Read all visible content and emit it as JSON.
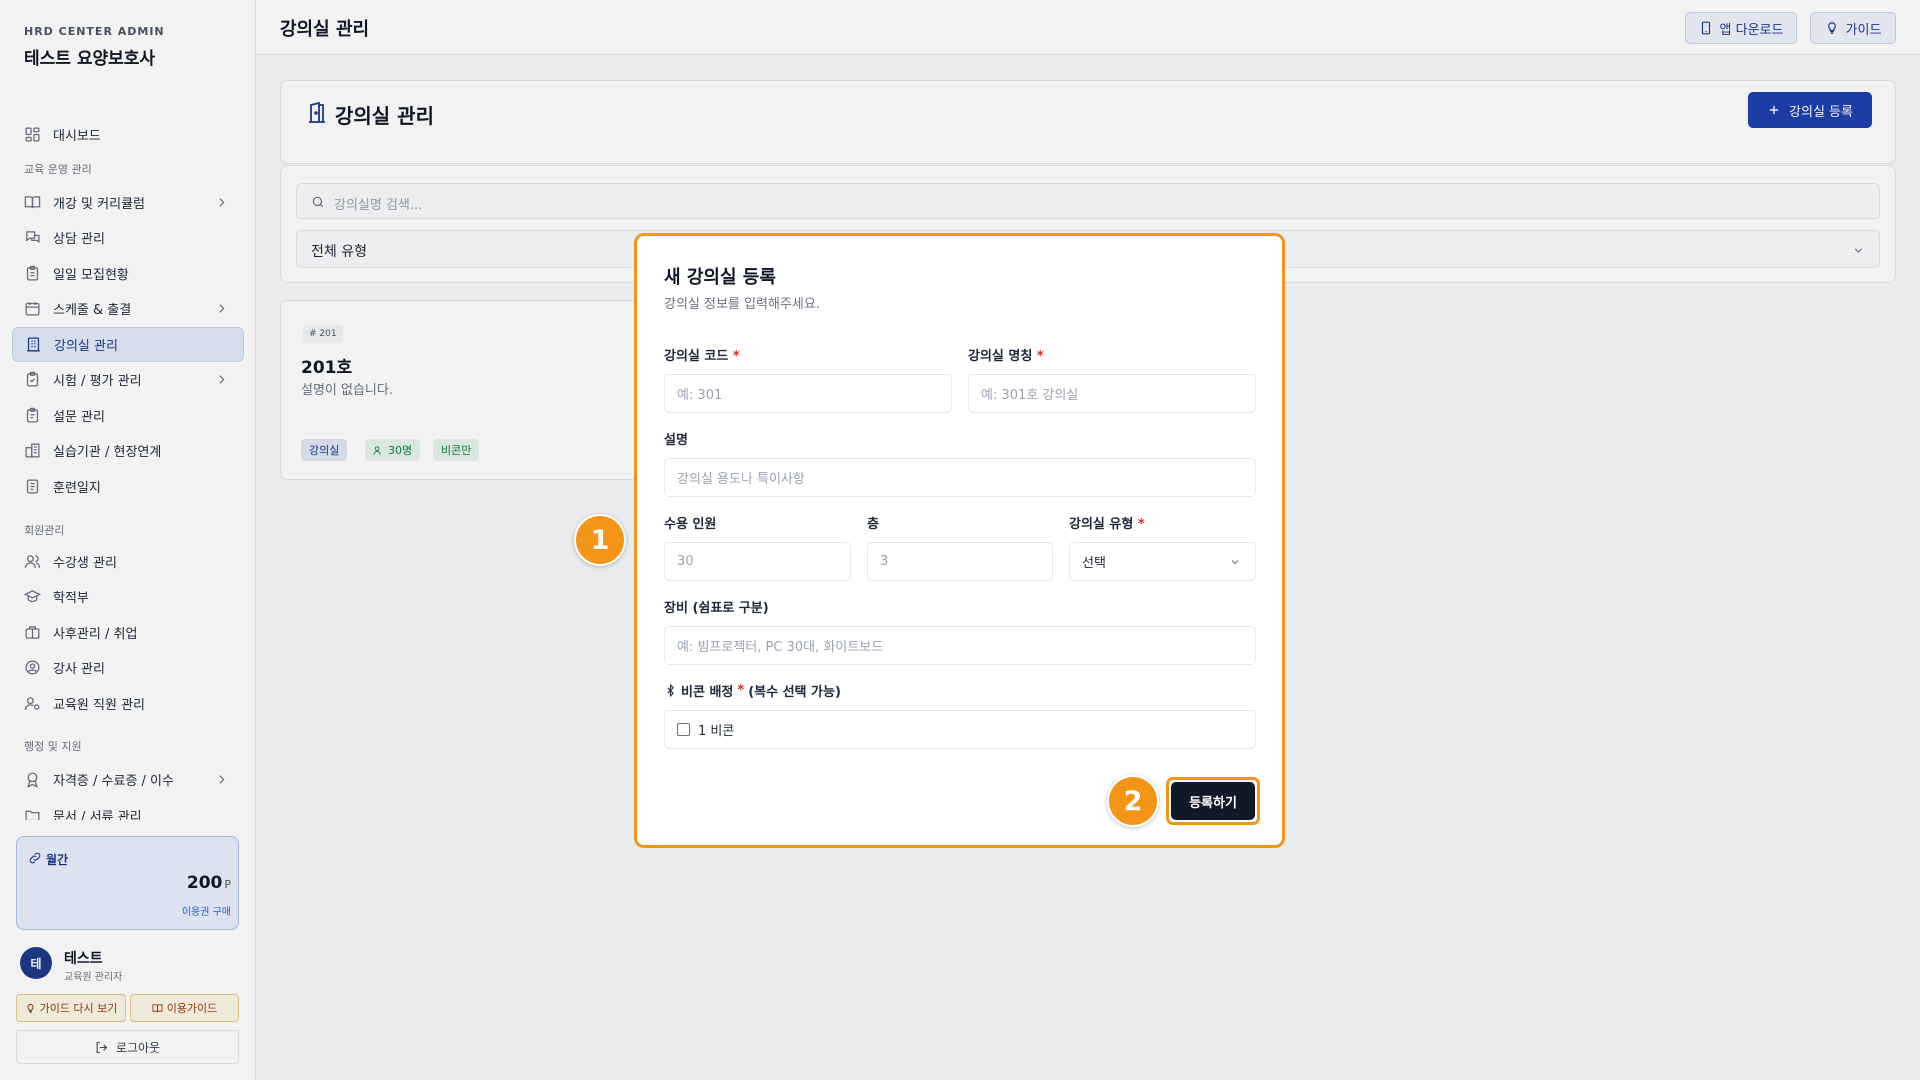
{
  "sidebar": {
    "brand_small": "HRD CENTER ADMIN",
    "brand_title": "테스트 요양보호사",
    "items": [
      {
        "label": "대시보드"
      },
      {
        "label": "개강 및 커리큘럼"
      },
      {
        "label": "상담 관리"
      },
      {
        "label": "일일 모집현황"
      },
      {
        "label": "스케줄 & 출결"
      },
      {
        "label": "강의실 관리"
      },
      {
        "label": "시험 / 평가 관리"
      },
      {
        "label": "설문 관리"
      },
      {
        "label": "실습기관 / 현장연계"
      },
      {
        "label": "훈련일지"
      },
      {
        "label": "수강생 관리"
      },
      {
        "label": "학적부"
      },
      {
        "label": "사후관리 / 취업"
      },
      {
        "label": "강사 관리"
      },
      {
        "label": "교육원 직원 관리"
      },
      {
        "label": "자격증 / 수료증 / 이수"
      },
      {
        "label": "문서 / 서류 관리"
      }
    ],
    "sections": [
      "교육 운영 관리",
      "회원관리",
      "행정 및 지원"
    ],
    "points": {
      "label": "월간",
      "value": "200",
      "unit": "P",
      "link": "이용권 구매"
    },
    "user": {
      "initial": "테",
      "name": "테스트",
      "role": "교육원 관리자"
    },
    "guide_again": "가이드 다시 보기",
    "usage_guide": "이용가이드",
    "logout": "로그아웃"
  },
  "topbar": {
    "title": "강의실 관리",
    "app_download": "앱 다운로드",
    "guide": "가이드"
  },
  "page": {
    "title": "강의실 관리",
    "register_button": "강의실 등록"
  },
  "filters": {
    "search_placeholder": "강의실명 검색...",
    "type_select": "전체 유형"
  },
  "room_card": {
    "code": "# 201",
    "name": "201호",
    "description": "설명이 없습니다.",
    "type_chip": "강의실",
    "capacity_chip": "30명",
    "beacon_chip": "비콘만"
  },
  "modal": {
    "title": "새 강의실 등록",
    "subtitle": "강의실 정보를 입력해주세요.",
    "code_label": "강의실 코드",
    "code_placeholder": "예: 301",
    "name_label": "강의실 명칭",
    "name_placeholder": "예: 301호 강의실",
    "desc_label": "설명",
    "desc_placeholder": "강의실 용도나 특이사항",
    "capacity_label": "수용 인원",
    "capacity_placeholder": "30",
    "floor_label": "층",
    "floor_placeholder": "3",
    "type_label": "강의실 유형",
    "type_select": "선택",
    "equipment_label": "장비 (쉼표로 구분)",
    "equipment_placeholder": "예: 빔프로젝터, PC 30대, 화이트보드",
    "beacon_label": "비콘 배정",
    "beacon_note": "(복수 선택 가능)",
    "beacon_option": "1 비콘",
    "submit": "등록하기",
    "required_mark": "*"
  },
  "steps": {
    "one": "1",
    "two": "2"
  },
  "colors": {
    "accent": "#1e40af",
    "highlight": "#f39617",
    "dark": "#111827"
  }
}
